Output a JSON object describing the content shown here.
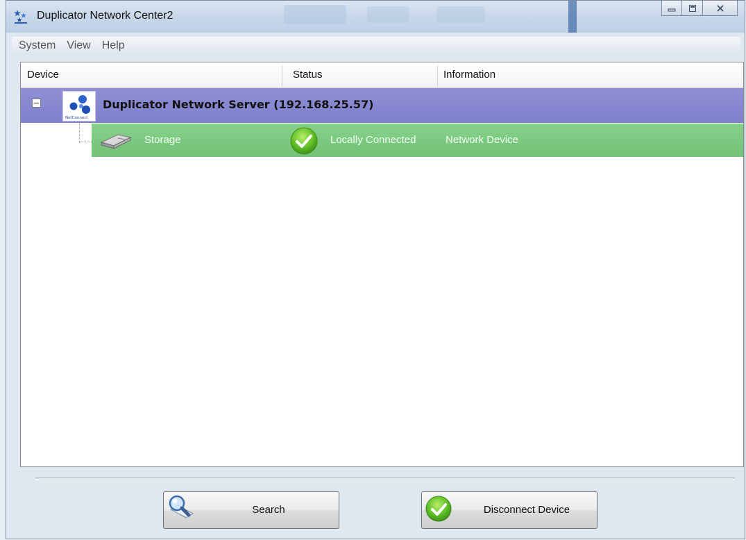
{
  "window": {
    "title": "Duplicator Network Center2",
    "controls": {
      "minimize": "–",
      "maximize": "□",
      "close": "✕"
    }
  },
  "menu": {
    "items": [
      "System",
      "View",
      "Help"
    ]
  },
  "list": {
    "columns": [
      "Device",
      "Status",
      "Information"
    ],
    "server": {
      "label": "Duplicator Network Server  (192.168.25.57)",
      "logo_text": "NetConnect",
      "expanded": true
    },
    "devices": [
      {
        "name": "Storage",
        "status": "Locally Connected",
        "information": "Network Device",
        "selected": true
      }
    ]
  },
  "buttons": {
    "search": "Search",
    "disconnect": "Disconnect Device"
  },
  "colors": {
    "server_row": "#8484d0",
    "device_row_selected": "#7cc980",
    "status_ok": "#63c229"
  }
}
